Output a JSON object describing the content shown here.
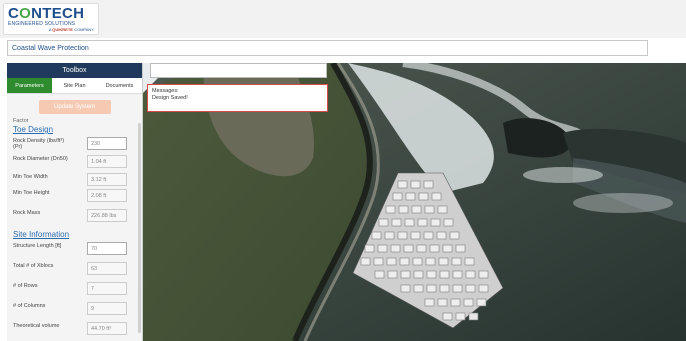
{
  "logo": {
    "brand_main": "CONTECH",
    "tagline": "ENGINEERED SOLUTIONS",
    "subtag_prefix": "A",
    "subtag_brand": "QUIKRETE",
    "subtag_suffix": "COMPANY"
  },
  "project": {
    "title": "Coastal Wave Protection"
  },
  "toolbox": {
    "title": "Toolbox",
    "tabs": [
      "Parameters",
      "Site Plan",
      "Documents"
    ],
    "update_button": "Update System",
    "factor_label": "Factor",
    "toe_design": {
      "title": "Toe Design",
      "fields": [
        {
          "label": "Rock Density (lbs/ft³) (Pr)",
          "value": "230",
          "editable": true
        },
        {
          "label": "Rock Diameter (Dn50)",
          "value": "1.04 ft",
          "editable": false
        },
        {
          "label": "Min Toe Width",
          "value": "3.12 ft",
          "editable": false
        },
        {
          "label": "Min Toe Height",
          "value": "2.08 ft",
          "editable": false
        },
        {
          "label": "Rock Mass",
          "value": "226.88 lbs",
          "editable": false
        }
      ]
    },
    "site_info": {
      "title": "Site Information",
      "fields": [
        {
          "label": "Structure Length [ft]",
          "value": "70",
          "editable": true
        },
        {
          "label": "Total # of Xblocs",
          "value": "63",
          "editable": false
        },
        {
          "label": "# of Rows",
          "value": "7",
          "editable": false
        },
        {
          "label": "# of Columns",
          "value": "9",
          "editable": false
        },
        {
          "label": "Theoretical volume",
          "value": "44.70 ft³",
          "editable": false
        }
      ]
    }
  },
  "messages": {
    "title": "Messages:",
    "text": "Design Saved!"
  }
}
